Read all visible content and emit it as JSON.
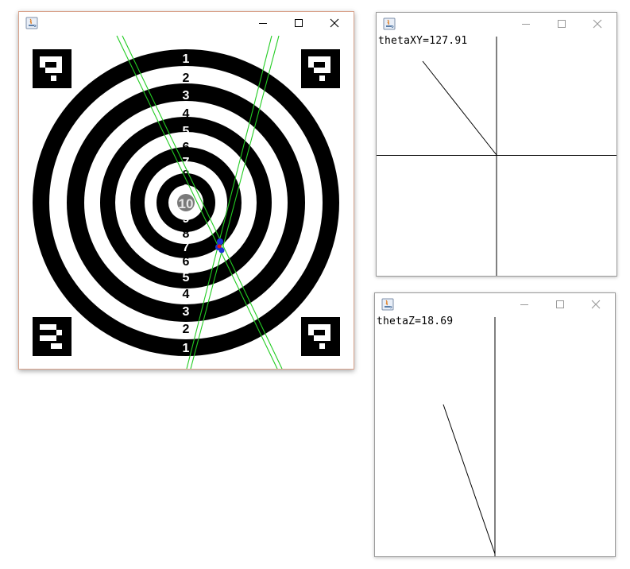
{
  "windows": {
    "target": {
      "title": "",
      "rings": [
        "1",
        "2",
        "3",
        "4",
        "5",
        "6",
        "7",
        "8",
        "9",
        "10",
        "9",
        "8",
        "7",
        "6",
        "5",
        "4",
        "3",
        "2",
        "1"
      ],
      "controls": {
        "minimize": "minimize-icon",
        "maximize": "maximize-icon",
        "close": "close-icon"
      }
    },
    "xy": {
      "title": "",
      "readout": "thetaXY=127.91"
    },
    "z": {
      "title": "",
      "readout": "thetaZ=18.69"
    }
  },
  "colors": {
    "accent_border": "#d9a38c",
    "laser_lines": "#22cc22",
    "marker_blue": "#1a33d6",
    "marker_red": "#e01818",
    "bullseye": "#7a7a7a"
  }
}
